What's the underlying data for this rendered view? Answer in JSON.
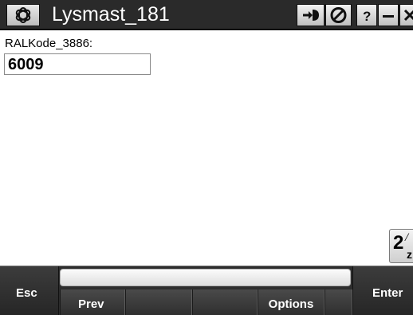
{
  "titlebar": {
    "title": "Lysmast_181",
    "app_icon": "trimble-logo-icon",
    "buttons": [
      {
        "name": "login-arrow-icon"
      },
      {
        "name": "disabled-circle-icon"
      },
      {
        "name": "help-icon",
        "label": "?"
      },
      {
        "name": "minimize-icon"
      },
      {
        "name": "close-icon"
      }
    ]
  },
  "form": {
    "field_label": "RALKode_3886:",
    "field_value": "6009"
  },
  "keyboard_toggle": {
    "main": "2",
    "sup": "/",
    "sub": "z"
  },
  "bottombar": {
    "esc_label": "Esc",
    "enter_label": "Enter",
    "softkeys": [
      {
        "label": "Prev"
      },
      {
        "label": ""
      },
      {
        "label": ""
      },
      {
        "label": "Options"
      },
      {
        "label": ""
      }
    ]
  },
  "colors": {
    "titlebar_bg": "#2a2a2a",
    "bottombar_bg": "#2d2d2d",
    "content_bg": "#ffffff"
  }
}
